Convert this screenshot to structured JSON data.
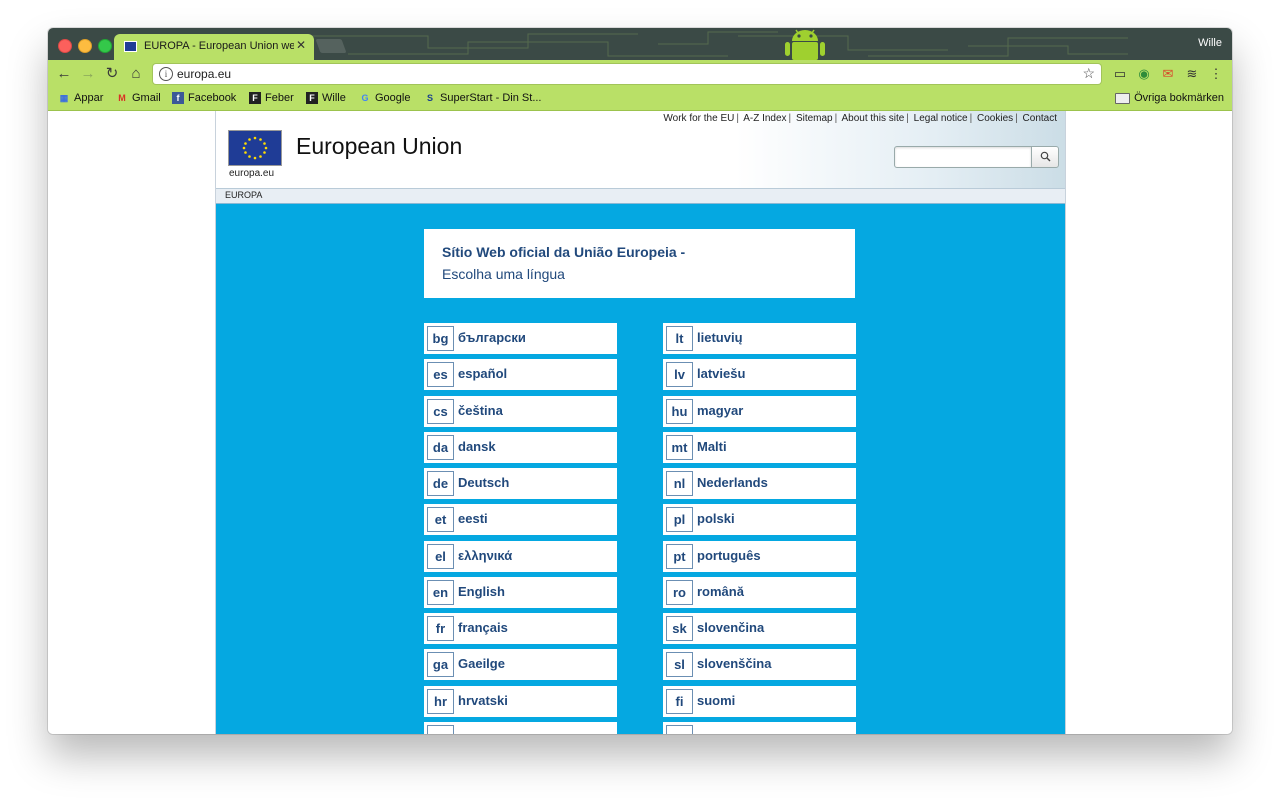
{
  "browser": {
    "tab_title": "EUROPA - European Union we",
    "user_name": "Wille",
    "url": "europa.eu",
    "bookmarks": [
      {
        "label": "Appar",
        "icon": "apps-grid-icon"
      },
      {
        "label": "Gmail",
        "icon": "gmail-icon"
      },
      {
        "label": "Facebook",
        "icon": "facebook-icon"
      },
      {
        "label": "Feber",
        "icon": "feber-icon"
      },
      {
        "label": "Wille",
        "icon": "feber-icon"
      },
      {
        "label": "Google",
        "icon": "google-icon"
      },
      {
        "label": "SuperStart - Din St...",
        "icon": "superstart-icon"
      }
    ],
    "other_bookmarks": "Övriga bokmärken"
  },
  "site": {
    "top_links": [
      "Work for the EU",
      "A-Z Index",
      "Sitemap",
      "About this site",
      "Legal notice",
      "Cookies",
      "Contact"
    ],
    "logo_caption": "europa.eu",
    "title": "European Union",
    "breadcrumb": "EUROPA",
    "intro_title": "Sítio Web oficial da União Europeia -",
    "intro_sub": "Escolha uma língua",
    "languages_left": [
      {
        "code": "bg",
        "name": "български"
      },
      {
        "code": "es",
        "name": "español"
      },
      {
        "code": "cs",
        "name": "čeština"
      },
      {
        "code": "da",
        "name": "dansk"
      },
      {
        "code": "de",
        "name": "Deutsch"
      },
      {
        "code": "et",
        "name": "eesti"
      },
      {
        "code": "el",
        "name": "ελληνικά"
      },
      {
        "code": "en",
        "name": "English"
      },
      {
        "code": "fr",
        "name": "français"
      },
      {
        "code": "ga",
        "name": "Gaeilge"
      },
      {
        "code": "hr",
        "name": "hrvatski"
      }
    ],
    "languages_right": [
      {
        "code": "lt",
        "name": "lietuvių"
      },
      {
        "code": "lv",
        "name": "latviešu"
      },
      {
        "code": "hu",
        "name": "magyar"
      },
      {
        "code": "mt",
        "name": "Malti"
      },
      {
        "code": "nl",
        "name": "Nederlands"
      },
      {
        "code": "pl",
        "name": "polski"
      },
      {
        "code": "pt",
        "name": "português"
      },
      {
        "code": "ro",
        "name": "română"
      },
      {
        "code": "sk",
        "name": "slovenčina"
      },
      {
        "code": "sl",
        "name": "slovenščina"
      },
      {
        "code": "fi",
        "name": "suomi"
      }
    ]
  },
  "colors": {
    "page_blue": "#05a8e1",
    "link_navy": "#21497c",
    "chrome_theme_green": "#b9e067"
  }
}
